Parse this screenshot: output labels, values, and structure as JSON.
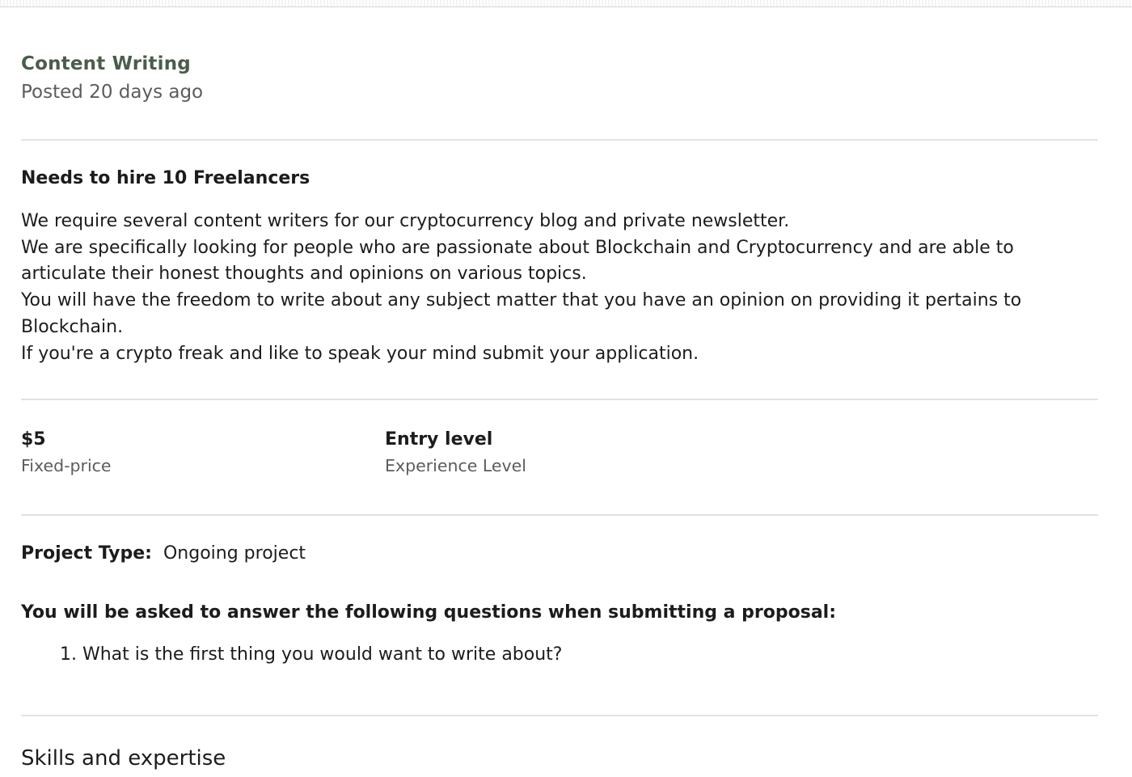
{
  "job": {
    "category": "Content Writing",
    "posted": "Posted 20 days ago",
    "hire_heading": "Needs to hire 10 Freelancers",
    "description": [
      "We require several content writers for our cryptocurrency blog and private newsletter.",
      "We are specifically looking for people who are passionate about Blockchain and Cryptocurrency and are able to articulate their honest thoughts and opinions on various topics.",
      "You will have the freedom to write about any subject matter that you have an opinion on providing it pertains to Blockchain.",
      "If you're a crypto freak and like to speak your mind submit your application."
    ]
  },
  "stats": {
    "price": {
      "value": "$5",
      "label": "Fixed-price"
    },
    "experience": {
      "value": "Entry level",
      "label": "Experience Level"
    }
  },
  "project_type": {
    "label": "Project Type:",
    "value": "Ongoing project"
  },
  "questions": {
    "heading": "You will be asked to answer the following questions when submitting a proposal:",
    "items": [
      "1. What is the first thing you would want to write about?"
    ]
  },
  "skills": {
    "heading": "Skills and expertise"
  }
}
